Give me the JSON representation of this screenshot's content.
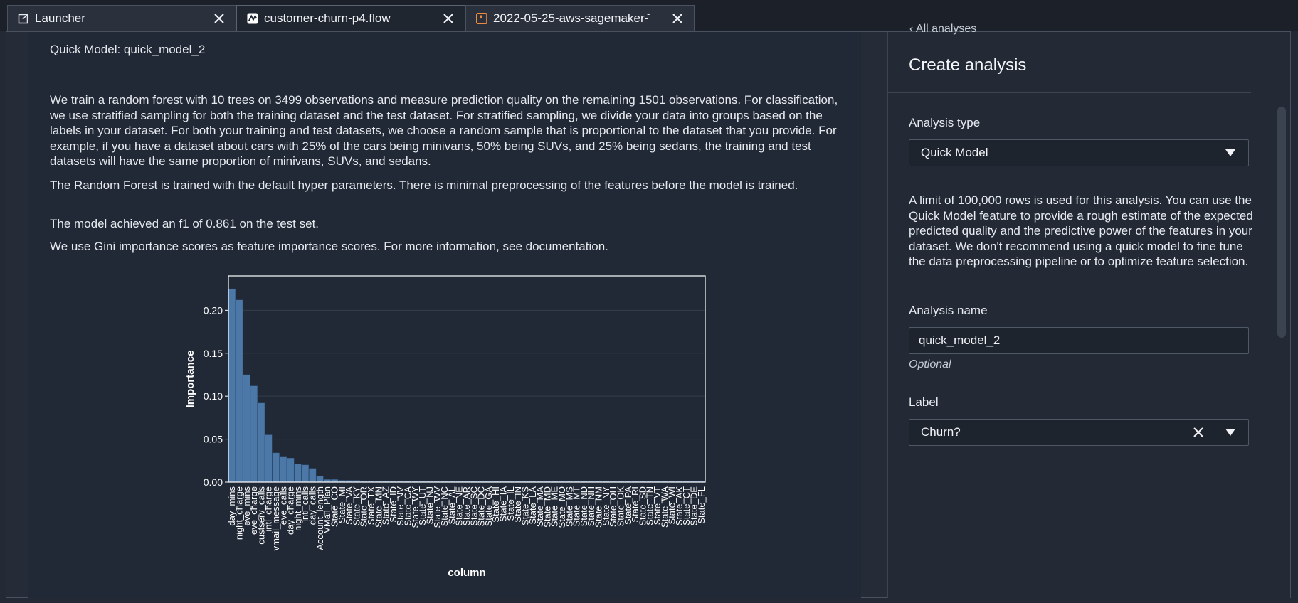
{
  "tabs": [
    {
      "label": "Launcher",
      "icon": "external-link-icon"
    },
    {
      "label": "customer-churn-p4.flow",
      "icon": "flow-icon"
    },
    {
      "label": "2022-05-25-aws-sagemaker-̆",
      "icon": "notebook-icon"
    }
  ],
  "report": {
    "title": "Quick Model: quick_model_2",
    "paragraph1": "We train a random forest with 10 trees on 3499 observations and measure prediction quality on the remaining 1501 observations. For classification, we use stratified sampling for both the training dataset and the test dataset. For stratified sampling, we divide your data into groups based on the labels in your dataset. For both your training and test datasets, we choose a random sample that is proportional to the dataset that you provide. For example, if you have a dataset about cars with 25% of the cars being minivans, 50% being SUVs, and 25% being sedans, the training and test datasets will have the same proportion of minivans, SUVs, and sedans.",
    "paragraph2": "The Random Forest is trained with the default hyper parameters. There is minimal preprocessing of the features before the model is trained.",
    "paragraph3": "The model achieved an f1 of 0.861 on the test set.",
    "paragraph4": "We use Gini importance scores as feature importance scores. For more information, see documentation."
  },
  "chart_data": {
    "type": "bar",
    "xlabel": "column",
    "ylabel": "Importance",
    "ylim": [
      0,
      0.24
    ],
    "yticks": [
      "0.00",
      "0.05",
      "0.10",
      "0.15",
      "0.20"
    ],
    "bar_color": "#4c78a8",
    "categories": [
      "day_mins",
      "night_charge",
      "eve_mins",
      "eve_charge",
      "custserv_calls",
      "intl_charge",
      "vmail_message",
      "eve_calls",
      "day_charge",
      "night_mins",
      "intl_calls",
      "day_calls",
      "Account_length",
      "VMail_Plan",
      "State_CO",
      "State_MI",
      "State_VA",
      "State_KY",
      "State_OR",
      "State_TX",
      "State_MN",
      "State_AZ",
      "State_ID",
      "State_NV",
      "State_CA",
      "State_WY",
      "State_UT",
      "State_NJ",
      "State_WV",
      "State_NC",
      "State_AL",
      "State_NE",
      "State_AR",
      "State_SC",
      "State_DC",
      "State_GA",
      "State_HI",
      "State_IA",
      "State_IL",
      "State_IN",
      "State_KS",
      "State_LA",
      "State_MA",
      "State_MD",
      "State_ME",
      "State_MO",
      "State_MS",
      "State_MT",
      "State_ND",
      "State_NH",
      "State_NM",
      "State_NY",
      "State_OH",
      "State_OK",
      "State_PA",
      "State_RI",
      "State_SD",
      "State_TN",
      "State_VT",
      "State_WA",
      "State_WI",
      "State_AK",
      "State_CT",
      "State_DE",
      "State_FL"
    ],
    "values": [
      0.225,
      0.212,
      0.125,
      0.112,
      0.092,
      0.055,
      0.034,
      0.03,
      0.028,
      0.021,
      0.02,
      0.016,
      0.007,
      0.003,
      0.003,
      0.002,
      0.002,
      0.002,
      0.001,
      0.001,
      0.001,
      0.001,
      0.001,
      0.001,
      0.001,
      0.001,
      0.001,
      0.001,
      0.001,
      0.001,
      0.001,
      0.001,
      0.001,
      0.001,
      0.001,
      0.001,
      0.001,
      0.001,
      0.001,
      0.001,
      0.001,
      0.001,
      0.001,
      0.001,
      0.001,
      0.001,
      0.001,
      0.001,
      0.001,
      0.001,
      0.001,
      0.001,
      0.001,
      0.001,
      0.001,
      0.001,
      0.001,
      0.001,
      0.001,
      0.001,
      0.001,
      0.001,
      0.001,
      0.001,
      0.001
    ]
  },
  "panel": {
    "back_link": "All analyses",
    "title": "Create analysis",
    "analysis_type_label": "Analysis type",
    "analysis_type_value": "Quick Model",
    "description": "A limit of 100,000 rows is used for this analysis. You can use the Quick Model feature to provide a rough estimate of the expected predicted quality and the predictive power of the features in your dataset. We don't recommend using a quick model to fine tune the data preprocessing pipeline or to optimize feature selection.",
    "analysis_name_label": "Analysis name",
    "analysis_name_value": "quick_model_2",
    "optional": "Optional",
    "label_label": "Label",
    "label_value": "Churn?"
  }
}
